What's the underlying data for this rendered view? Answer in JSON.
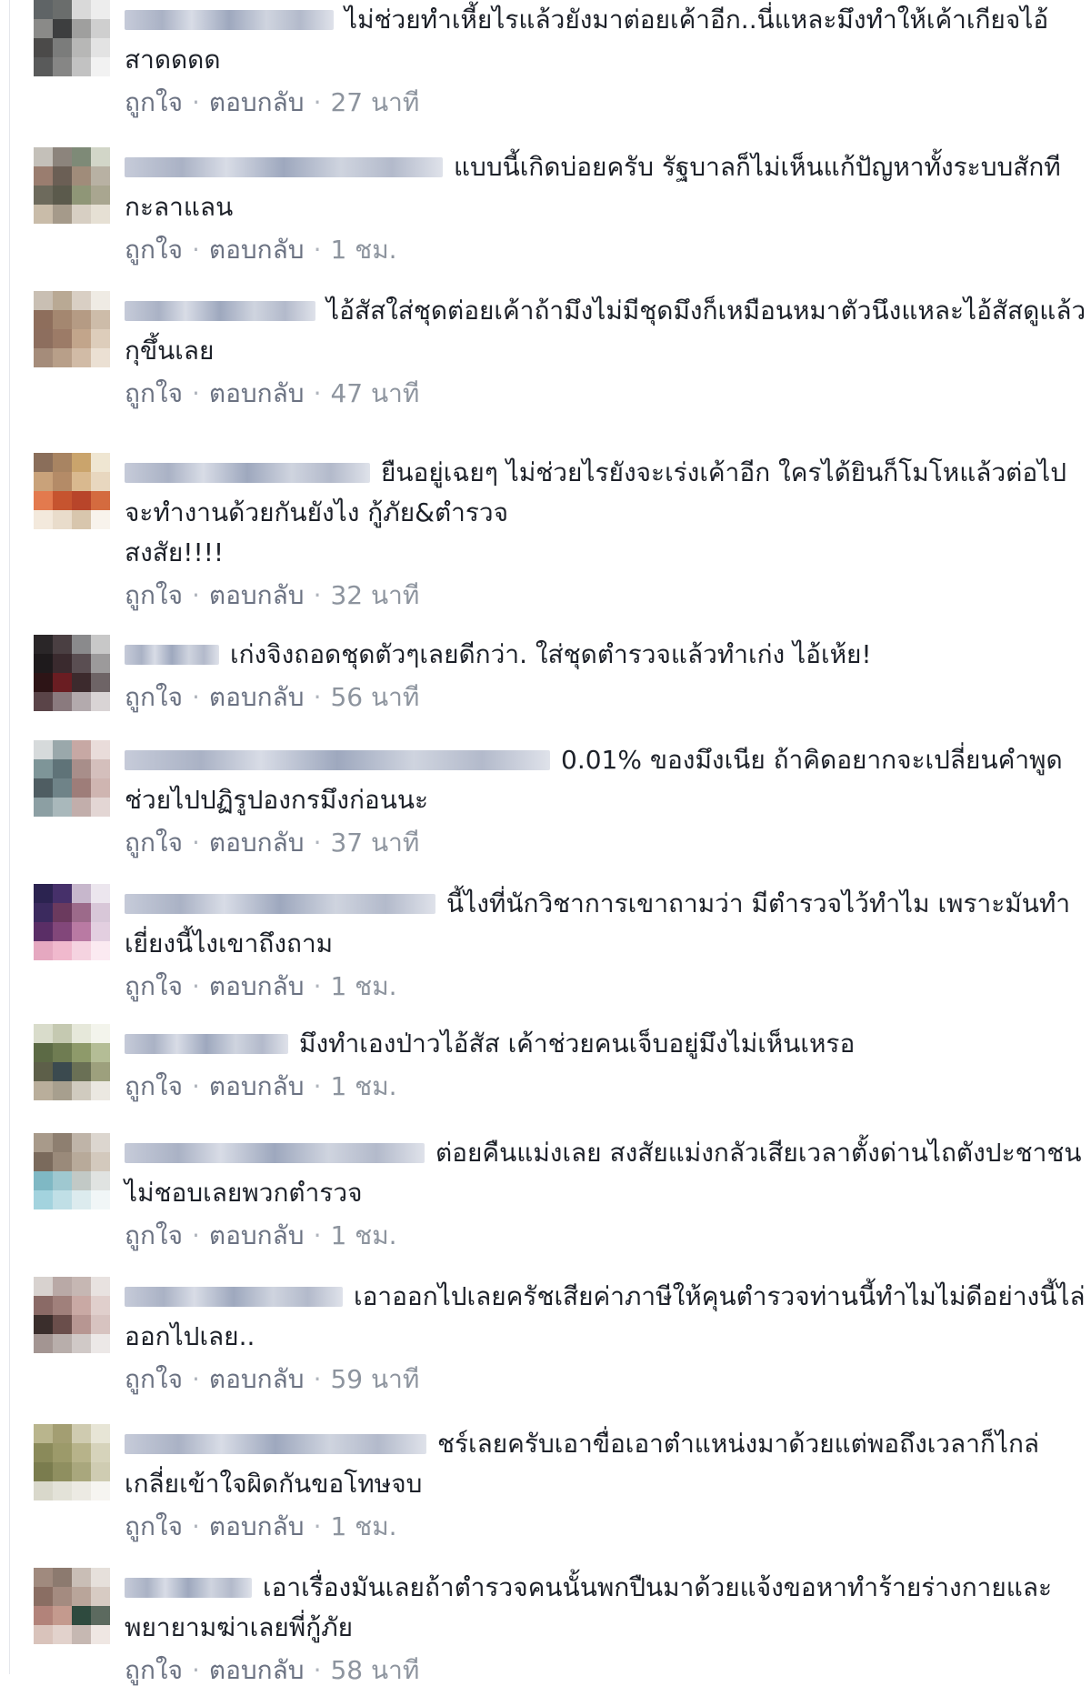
{
  "actions": {
    "like": "ถูกใจ",
    "reply": "ตอบกลับ",
    "separator": "·"
  },
  "comments": [
    {
      "text": "ไม่ช่วยทำเหี้ยไรแล้วยังมาต่อยเค้าอีก..นี่แหละมึงทำให้เค้าเกียจไอ้สาดดดด",
      "time": "27 นาที"
    },
    {
      "text": "แบบนี้เกิดบ่อยครับ รัฐบาลก็ไม่เห็นแก้ปัญหาทั้งระบบสักที กะลาแลน",
      "time": "1 ชม."
    },
    {
      "text": "ไอ้สัสใส่ชุดต่อยเค้าถ้ามึงไม่มีชุดมึงก็เหมือนหมาตัวนึงแหละไอ้สัสดูแล้วกุขึ้นเลย",
      "time": "47 นาที"
    },
    {
      "text": "ยืนอยู่เฉยๆ ไม่ช่วยไรยังจะเร่งเค้าอีก ใครได้ยินก็โมโหแล้วต่อไปจะทำงานด้วยกันยังไง กู้ภัย&ตำรวจ\nสงสัย!!!!",
      "time": "32 นาที"
    },
    {
      "text": "เก่งจิงถอดชุดตัวๆเลยดีกว่า. ใส่ชุดตำรวจแล้วทำเก่ง ไอ้เห้ย!",
      "time": "56 นาที"
    },
    {
      "text": "0.01% ของมึงเนีย ถ้าคิดอยากจะเปลี่ยนคำพูด ช่วยไปปฏิรูปองกรมึงก่อนนะ",
      "time": "37 นาที"
    },
    {
      "text": "นี้ไงที่นักวิชาการเขาถามว่า มีตำรวจไว้ทำไม เพราะมันทำเยี่ยงนี้ไงเขาถึงถาม",
      "time": "1 ชม."
    },
    {
      "text": "มึงทำเองป่าวไอ้สัส เค้าช่วยคนเจ็บอยู่มึงไม่เห็นเหรอ",
      "time": "1 ชม."
    },
    {
      "text": "ต่อยคืนแม่งเลย สงสัยแม่งกลัวเสียเวลาตั้งด่านไถตังปะชาชน ไม่ชอบเลยพวกตำรวจ",
      "time": "1 ชม."
    },
    {
      "text": "เอาออกไปเลยครัชเสียค่าภาษีให้คุนตำรวจท่านนี้ทำไมไม่ดีอย่างนี้ไล่ออกไปเลย..",
      "time": "59 นาที"
    },
    {
      "text": "ชร์เลยครับเอาขื่อเอาตำแหน่งมาด้วยแต่พอถึงเวลาก็ไกล่เกลี่ยเข้าใจผิดกันขอโทษจบ",
      "time": "1 ชม."
    },
    {
      "text": "เอาเรื่องมันเลยถ้าตำรวจคนนั้นพกปืนมาด้วยแจ้งขอหาทำร้ายร่างกายและพยายามฆ่าเลยพี่กู้ภัย",
      "time": "58 นาที"
    }
  ]
}
